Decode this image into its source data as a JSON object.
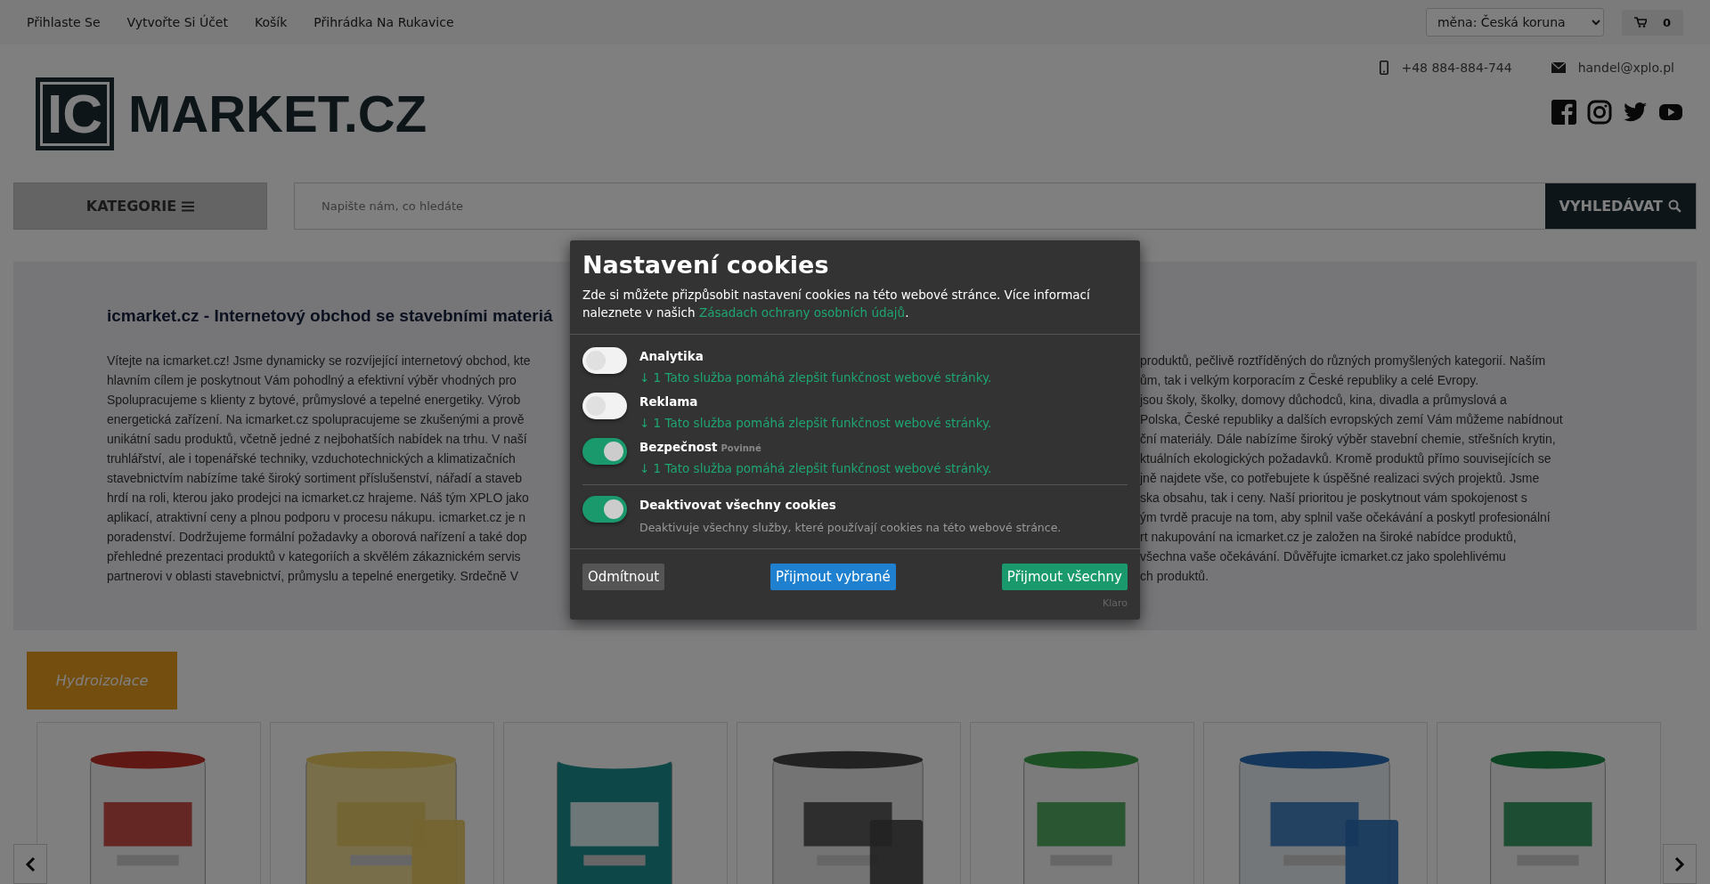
{
  "top_bar": {
    "links": [
      "Přihlaste Se",
      "Vytvořte Si Účet",
      "Košík",
      "Přihrádka Na Rukavice"
    ],
    "currency_select": {
      "value": "měna: Česká koruna"
    },
    "cart": {
      "count": "0"
    }
  },
  "header": {
    "logo": {
      "mark": "IC",
      "name": "MARKET.CZ"
    },
    "phone": "+48 884-884-744",
    "email": "handel@xplo.pl"
  },
  "category_button": {
    "label": "KATEGORIE"
  },
  "search": {
    "placeholder": "Napište nám, co hledáte",
    "button": "VYHLEDÁVAT"
  },
  "intro": {
    "title": "icmarket.cz - Internetový obchod se stavebními materiá",
    "lines": [
      {
        "left": "Vítejte na icmarket.cz! Jsme dynamicky se rozvíjející internetový obchod, kte",
        "right": "produktů, pečlivě roztříděných do různých promyšlených kategorií. Naším"
      },
      {
        "left": "hlavním cílem je poskytnout Vám pohodlný a efektivní výběr vhodných pro",
        "right": "ům, tak i velkým korporacím z České republiky a celé Evropy."
      },
      {
        "left": "Spolupracujeme s klienty z bytové, průmyslové a tepelné energetiky. Výrob",
        "right": "jsou školy, školky, domovy důchodců, kina, divadla a průmyslová a"
      },
      {
        "left": "energetická zařízení. Na icmarket.cz spolupracujeme se zkušenými a prově",
        "right": "Polska, České republiky a dalších evropských zemí Vám můžeme nabídnout"
      },
      {
        "left": "unikátní sadu produktů, včetně jedné z nejbohatších nabídek na trhu. V naší",
        "right": "ční materiály. Dále nabízíme široký výběr stavební chemie, střešních krytin,"
      },
      {
        "left": "truhlářství, ale i topenářské techniky, vzduchotechnických a klimatizačních",
        "right": "ktuálních ekologických požadavků. Kromě produktů přímo souvisejících se"
      },
      {
        "left": "stavebnictvím nabízíme také široký sortiment příslušenství, nářadí a staveb",
        "right": "jně najdete vše, co potřebujete k úspěšné realizaci svých projektů. Jsme"
      },
      {
        "left": "hrdí na roli, kterou jako prodejci na icmarket.cz hrajeme. Náš tým XPLO jako",
        "right": "ska obsahu, tak i ceny. Naší prioritou je poskytnout vám spokojenost s"
      },
      {
        "left": "aplikací, atraktivní ceny a plnou podporu v procesu nákupu. icmarket.cz je n",
        "right": "ým tvrdě pracuje na tom, aby splnil vaše očekávání a poskytl profesionální"
      },
      {
        "left": "poradenství. Dodržujeme formální požadavky a oborová nařízení a také dop",
        "right": "rt nakupování na icmarket.cz je založen na široké nabídce produktů,"
      },
      {
        "left": "přehledné prezentaci produktů v kategoriích a skvělém zákaznickém servis",
        "right": "všechna vaše očekávání. Důvěřujte icmarket.cz jako spolehlivému"
      },
      {
        "left": "partnerovi v oblasti stavebnictví, průmyslu a tepelné energetiky. Srdečně V",
        "right": "ch produktů."
      }
    ]
  },
  "category_tag": "Hydroizolace",
  "cookie_dialog": {
    "title": "Nastavení cookies",
    "intro": "Zde si můžete přizpůsobit nastavení cookies na této webové stránce. Více informací naleznete v našich ",
    "link": "Zásadach ochrany osobních údajů",
    "intro_end": ".",
    "services": [
      {
        "name": "Analytika",
        "on": false,
        "description": "↓ 1 Tato služba pomáhá zlepšit funkčnost webové stránky."
      },
      {
        "name": "Reklama",
        "on": false,
        "description": "↓ 1 Tato služba pomáhá zlepšit funkčnost webové stránky."
      },
      {
        "name": "Bezpečnost",
        "on": true,
        "required_label": "Povinné",
        "description": "↓ 1 Tato služba pomáhá zlepšit funkčnost webové stránky."
      }
    ],
    "toggle_all": {
      "label": "Deaktivovat všechny cookies",
      "on": true,
      "description": "Deaktivuje všechny služby, které používají cookies na této webové stránce."
    },
    "buttons": [
      {
        "kind": "decline",
        "label": "Odmítnout"
      },
      {
        "kind": "accept_selected",
        "label": "Přijmout vybrané"
      },
      {
        "kind": "accept_all",
        "label": "Přijmout všechny"
      }
    ],
    "footer": "Klaro"
  }
}
